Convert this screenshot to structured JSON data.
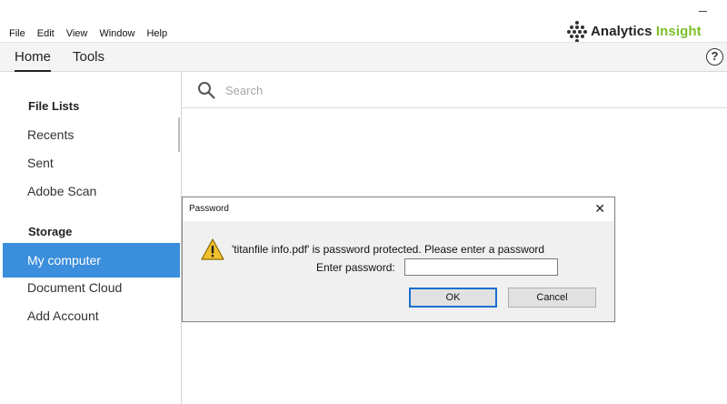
{
  "menu": [
    "File",
    "Edit",
    "View",
    "Window",
    "Help"
  ],
  "brand": {
    "text_main": "Analytics ",
    "text_accent": "Insight",
    "accent_color": "#7cbf2c"
  },
  "tabs": {
    "home": "Home",
    "tools": "Tools",
    "help_icon": "?"
  },
  "sidebar": {
    "file_lists_heading": "File Lists",
    "file_items": [
      "Recents",
      "Sent",
      "Adobe Scan"
    ],
    "storage_heading": "Storage",
    "storage_items": [
      "My computer",
      "Document Cloud",
      "Add Account"
    ],
    "selected_item": "My computer",
    "selected_color": "#3a8edb"
  },
  "search": {
    "placeholder": "Search"
  },
  "dialog": {
    "title": "Password",
    "close_symbol": "✕",
    "message": "'titanfile info.pdf' is password protected. Please enter a password",
    "password_label": "Enter password:",
    "password_value": "",
    "ok_label": "OK",
    "cancel_label": "Cancel"
  }
}
